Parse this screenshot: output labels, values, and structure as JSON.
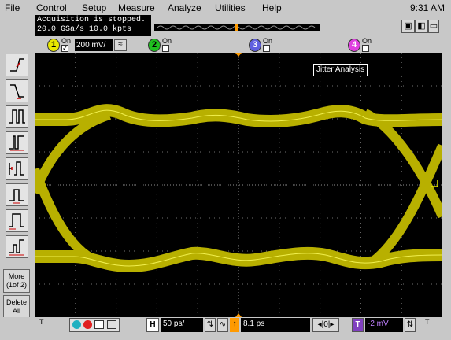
{
  "menu": {
    "items": [
      "File",
      "Control",
      "Setup",
      "Measure",
      "Analyze",
      "Utilities",
      "Help"
    ],
    "clock": "9:31 AM"
  },
  "status": {
    "line1": "Acquisition is stopped.",
    "line2": "20.0 GSa/s  10.0 kpts"
  },
  "channels": [
    {
      "num": "1",
      "on_label": "On",
      "checked": true,
      "scale": "200 mV/",
      "coupling": "≈",
      "color": "#e8e800"
    },
    {
      "num": "2",
      "on_label": "On",
      "checked": false,
      "color": "#20c020"
    },
    {
      "num": "3",
      "on_label": "On",
      "checked": false,
      "color": "#6060e0"
    },
    {
      "num": "4",
      "on_label": "On",
      "checked": false,
      "color": "#e040e0"
    }
  ],
  "left_buttons": {
    "more": "More\n(1of 2)",
    "more_line1": "More",
    "more_line2": "(1of 2)",
    "delete_line1": "Delete",
    "delete_line2": "All"
  },
  "screen": {
    "overlay_label": "Jitter Analysis",
    "trace_color": "#b8b000",
    "highlight_color": "#ffff60"
  },
  "bottom": {
    "horiz_badge": "H",
    "horiz_scale": "50 ps/",
    "trigger_delay": "8.1 ps",
    "trig_badge": "T",
    "trig_level": "-2 mV",
    "t_marker": "T",
    "t_marker2": "T"
  }
}
